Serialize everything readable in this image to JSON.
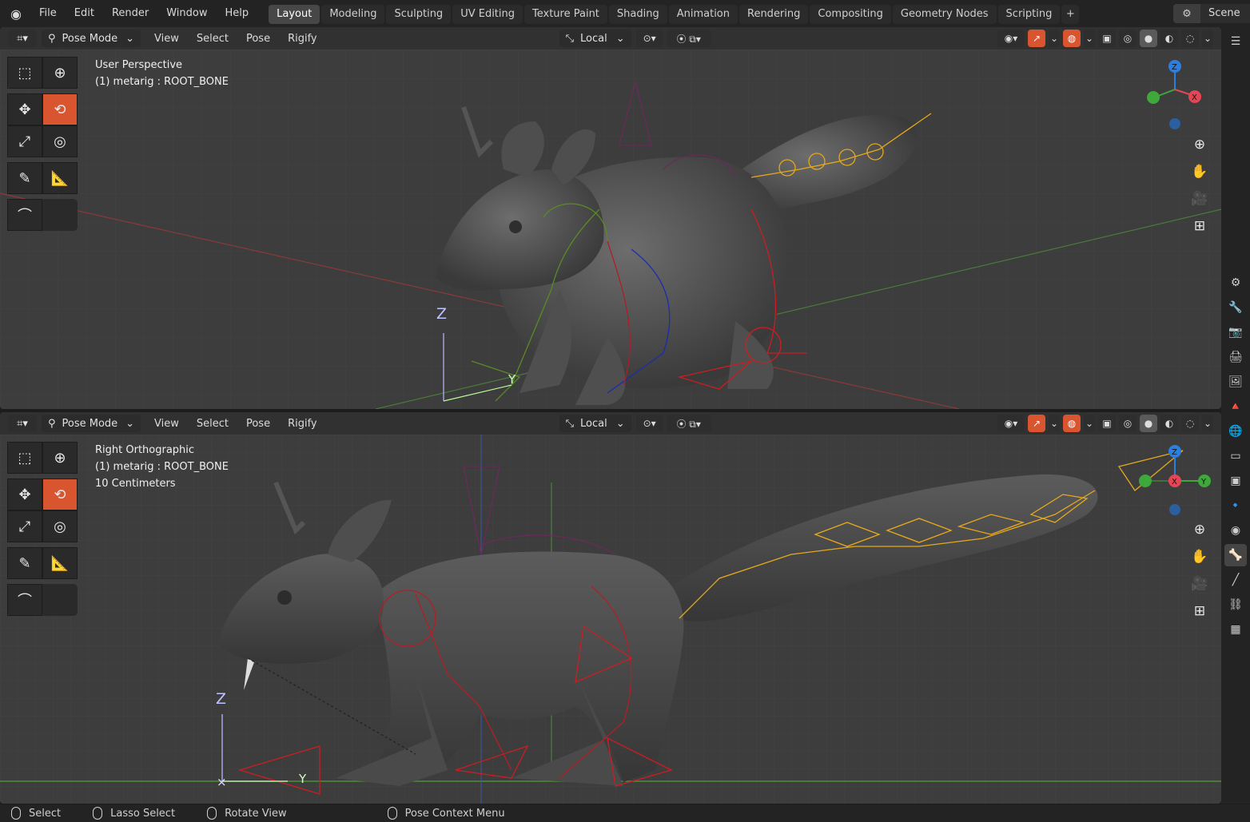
{
  "app": {
    "menus": [
      "File",
      "Edit",
      "Render",
      "Window",
      "Help"
    ],
    "workspaces": [
      "Layout",
      "Modeling",
      "Sculpting",
      "UV Editing",
      "Texture Paint",
      "Shading",
      "Animation",
      "Rendering",
      "Compositing",
      "Geometry Nodes",
      "Scripting"
    ],
    "active_workspace": "Layout",
    "scene_name": "Scene"
  },
  "viewport_top": {
    "mode": "Pose Mode",
    "menus": [
      "View",
      "Select",
      "Pose",
      "Rigify"
    ],
    "orientation": "Local",
    "view_name": "User Perspective",
    "object_info": "(1) metarig : ROOT_BONE"
  },
  "viewport_bottom": {
    "mode": "Pose Mode",
    "menus": [
      "View",
      "Select",
      "Pose",
      "Rigify"
    ],
    "orientation": "Local",
    "view_name": "Right Orthographic",
    "object_info": "(1) metarig : ROOT_BONE",
    "scale_info": "10 Centimeters"
  },
  "axes": {
    "z": "Z",
    "y": "Y",
    "x": "X"
  },
  "statusbar": {
    "items": [
      "Select",
      "Lasso Select",
      "Rotate View",
      "Pose Context Menu"
    ]
  },
  "colors": {
    "accent": "#d9552f",
    "viewport_bg": "#3d3d3d",
    "axis_x": "#e64555",
    "axis_y": "#3fa83a",
    "axis_z": "#2b7fe0"
  }
}
